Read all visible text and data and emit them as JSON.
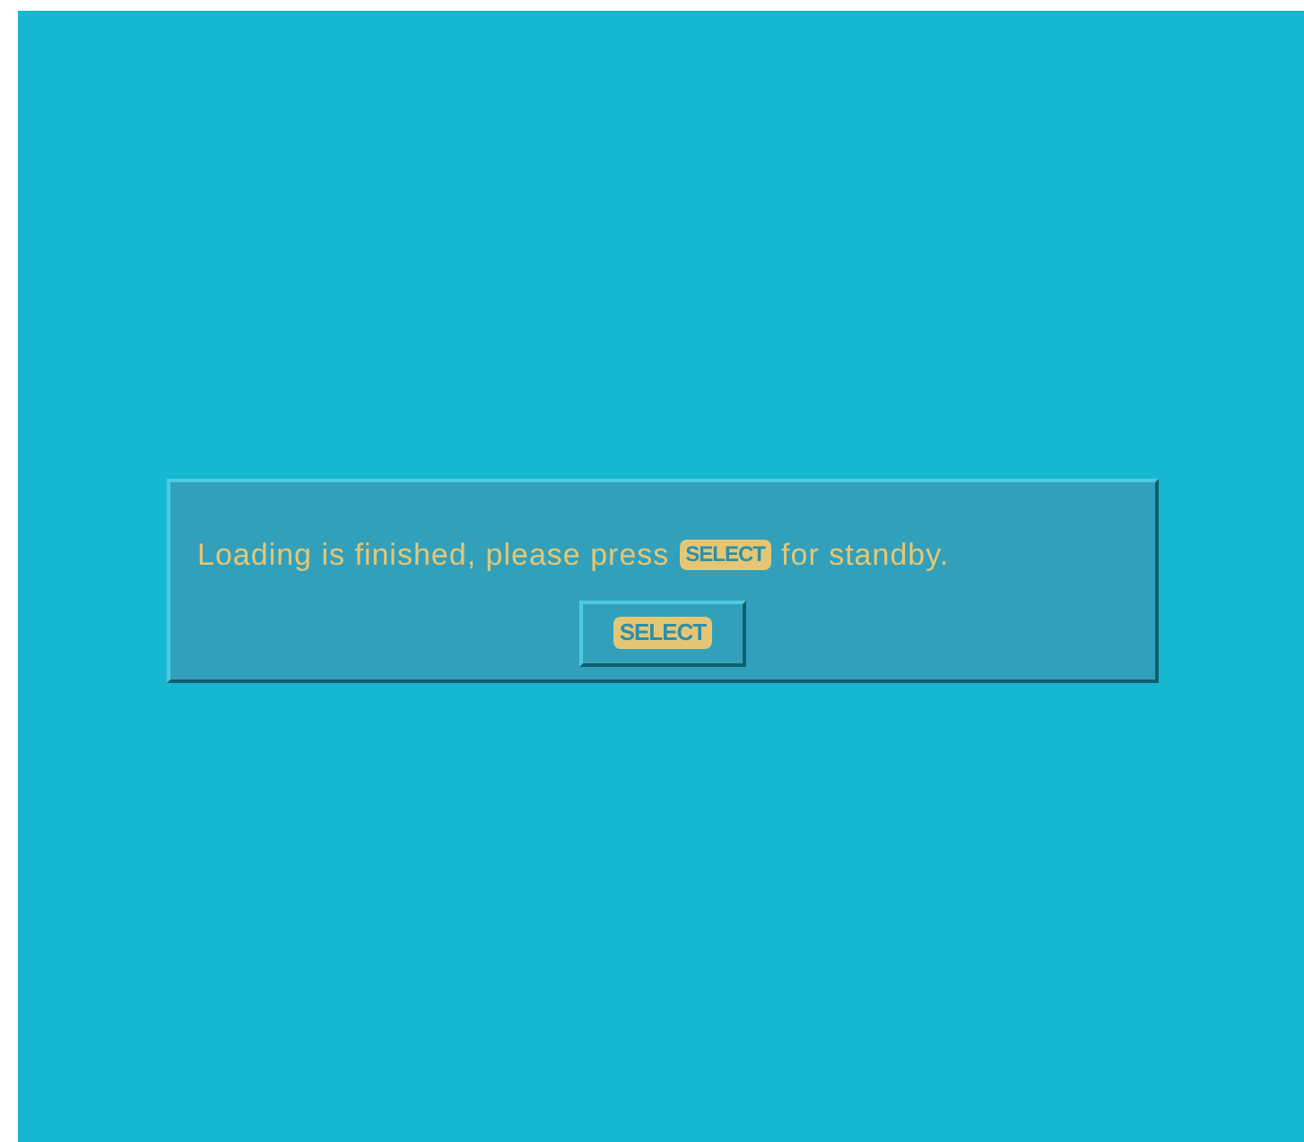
{
  "dialog": {
    "message_before": "Loading is finished, please press",
    "message_key": "SELECT",
    "message_after": "for standby."
  },
  "button": {
    "label": "SELECT"
  }
}
